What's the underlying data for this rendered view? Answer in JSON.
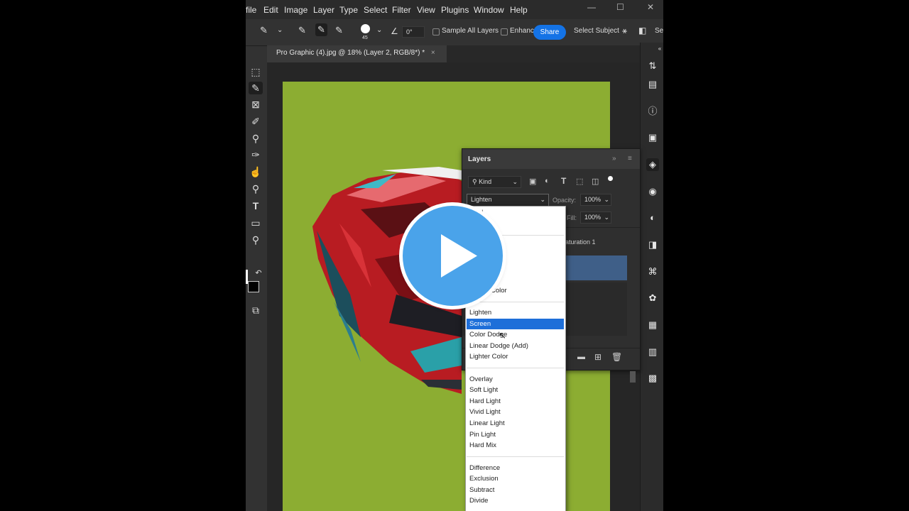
{
  "menu": [
    "File",
    "Edit",
    "Image",
    "Layer",
    "Type",
    "Select",
    "Filter",
    "View",
    "Plugins",
    "Window",
    "Help"
  ],
  "menu_visible": [
    "file",
    "Edit",
    "Image",
    "Layer",
    "Type",
    "Select",
    "Filter",
    "View",
    "Plugins",
    "Window",
    "Help"
  ],
  "options": {
    "brush_size": "45",
    "angle": "0°",
    "sample_all_layers": "Sample All Layers",
    "enhance": "Enhanc",
    "share": "Share",
    "select_subject": "Select Subject",
    "select_mask": "Se"
  },
  "document_tab": {
    "title": "Pro Graphic (4).jpg @ 18% (Layer 2, RGB/8*) *",
    "close": "×"
  },
  "layers_panel": {
    "title": "Layers",
    "filter_kind": "Kind",
    "blend_mode": "Lighten",
    "opacity_label": "Opacity:",
    "opacity_value": "100%",
    "fill_label": "Fill:",
    "fill_value": "100%",
    "layer_name_partial": "aturation 1"
  },
  "blend_menu": {
    "partial_top": "al",
    "partial_color": "Color",
    "groups": [
      [
        "Lighten",
        "Screen",
        "Color Dodge",
        "Linear Dodge (Add)",
        "Lighter Color"
      ],
      [
        "Overlay",
        "Soft Light",
        "Hard Light",
        "Vivid Light",
        "Linear Light",
        "Pin Light",
        "Hard Mix"
      ],
      [
        "Difference",
        "Exclusion",
        "Subtract",
        "Divide"
      ]
    ],
    "selected": "Screen"
  },
  "colors": {
    "artboard": "#8cad32",
    "accent": "#1473e6",
    "selection": "#1e6fd9",
    "play": "#4aa3ea"
  }
}
